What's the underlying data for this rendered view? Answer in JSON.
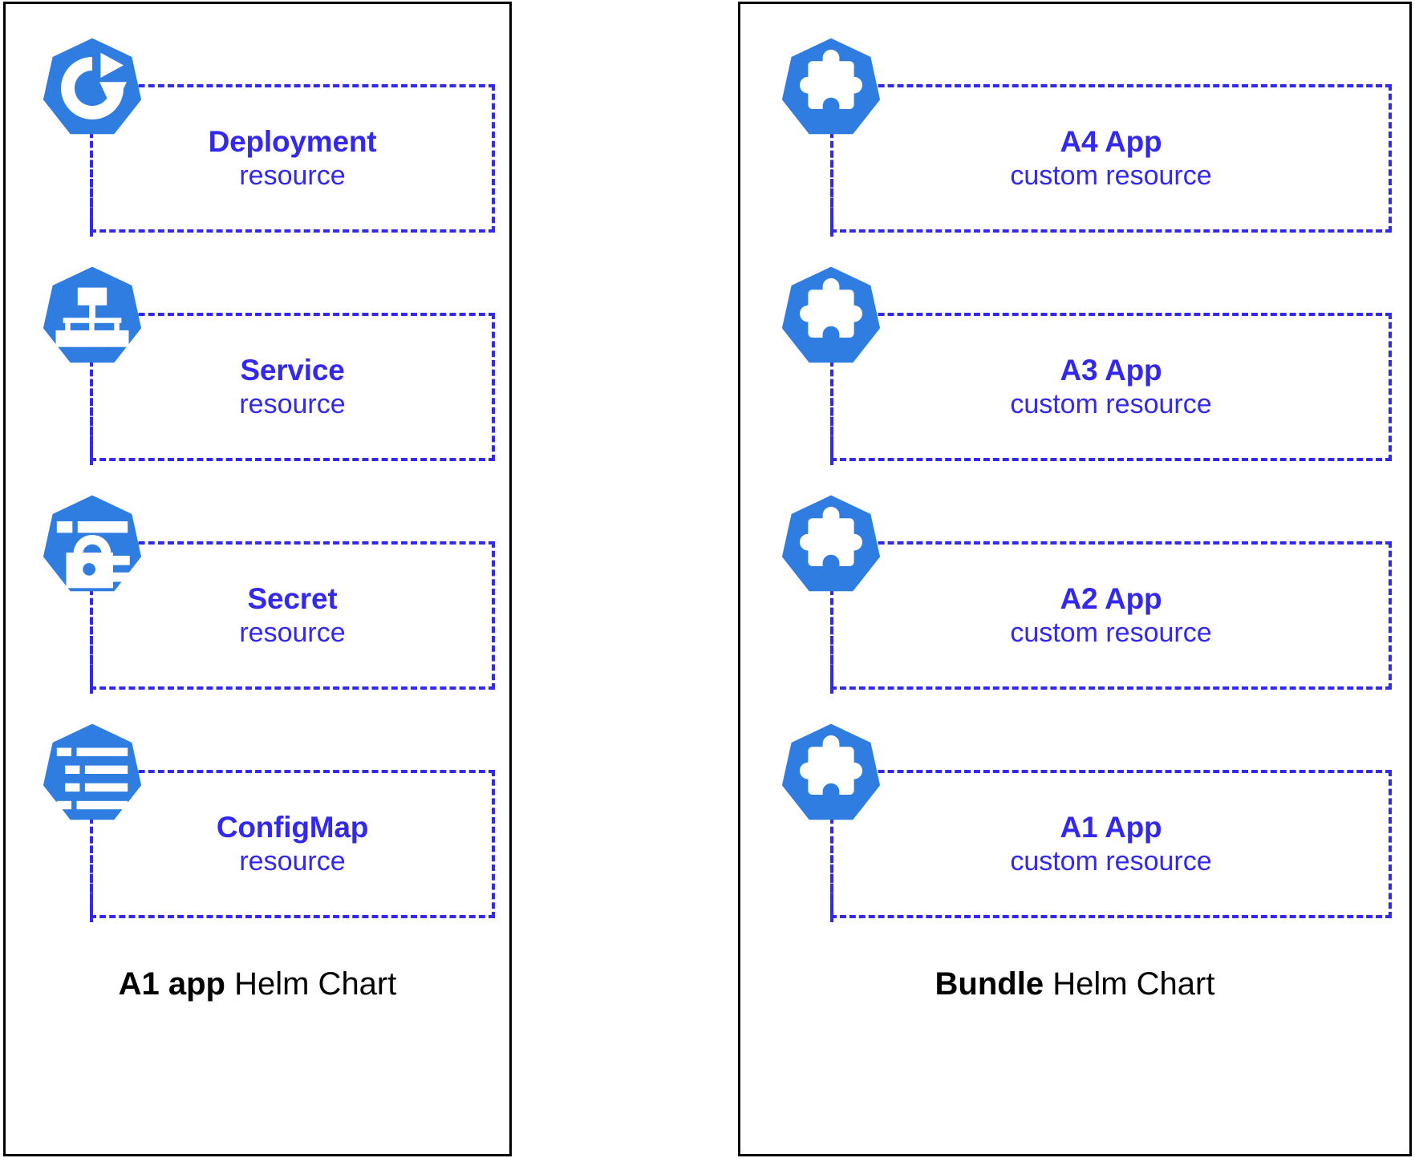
{
  "diagram": {
    "title_colors": {
      "icon_blue": "#2f7de1",
      "text_blue": "#3328f0",
      "border_black": "#000000",
      "background": "#ffffff"
    },
    "panels": [
      {
        "id": "a1-app-helm-chart",
        "caption_bold": "A1 app",
        "caption_rest": " Helm Chart",
        "items": [
          {
            "icon": "deployment-icon",
            "title": "Deployment",
            "subtitle": "resource"
          },
          {
            "icon": "service-icon",
            "title": "Service",
            "subtitle": "resource"
          },
          {
            "icon": "secret-icon",
            "title": "Secret",
            "subtitle": "resource"
          },
          {
            "icon": "configmap-icon",
            "title": "ConfigMap",
            "subtitle": "resource"
          }
        ]
      },
      {
        "id": "bundle-helm-chart",
        "caption_bold": "Bundle",
        "caption_rest": " Helm Chart",
        "items": [
          {
            "icon": "custom-resource-puzzle-icon",
            "title": "A4 App",
            "subtitle": "custom resource"
          },
          {
            "icon": "custom-resource-puzzle-icon",
            "title": "A3 App",
            "subtitle": "custom resource"
          },
          {
            "icon": "custom-resource-puzzle-icon",
            "title": "A2 App",
            "subtitle": "custom resource"
          },
          {
            "icon": "custom-resource-puzzle-icon",
            "title": "A1 App",
            "subtitle": "custom resource"
          }
        ]
      }
    ]
  }
}
